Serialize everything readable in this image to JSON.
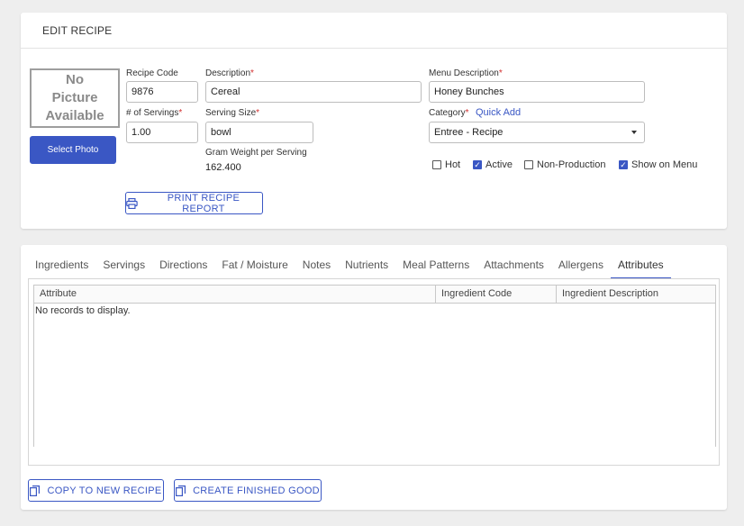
{
  "header": {
    "title": "EDIT RECIPE"
  },
  "photo": {
    "placeholder_line1": "No",
    "placeholder_line2": "Picture",
    "placeholder_line3": "Available",
    "select_label": "Select Photo"
  },
  "fields": {
    "recipe_code": {
      "label": "Recipe Code",
      "value": "9876"
    },
    "description": {
      "label": "Description",
      "required": "*",
      "value": "Cereal"
    },
    "menu_description": {
      "label": "Menu Description",
      "required": "*",
      "value": "Honey Bunches"
    },
    "servings": {
      "label": "# of Servings",
      "required": "*",
      "value": "1.00"
    },
    "serving_size": {
      "label": "Serving Size",
      "required": "*",
      "value": "bowl"
    },
    "category": {
      "label": "Category",
      "required": "*",
      "quick_add": "Quick Add",
      "value": "Entree - Recipe"
    },
    "gram_weight": {
      "label": "Gram Weight per Serving",
      "value": "162.400"
    }
  },
  "checkboxes": [
    {
      "label": "Hot",
      "checked": false
    },
    {
      "label": "Active",
      "checked": true
    },
    {
      "label": "Non-Production",
      "checked": false
    },
    {
      "label": "Show on Menu",
      "checked": true
    }
  ],
  "print_button": "PRINT RECIPE REPORT",
  "tabs": [
    "Ingredients",
    "Servings",
    "Directions",
    "Fat / Moisture",
    "Notes",
    "Nutrients",
    "Meal Patterns",
    "Attachments",
    "Allergens",
    "Attributes"
  ],
  "active_tab": "Attributes",
  "grid": {
    "columns": [
      "Attribute",
      "Ingredient Code",
      "Ingredient Description"
    ],
    "empty_message": "No records to display."
  },
  "footer": {
    "copy_button": "COPY TO NEW RECIPE",
    "finished_good_button": "CREATE FINISHED GOOD"
  },
  "colors": {
    "accent": "#3a57c4",
    "required": "#d32f2f",
    "background": "#eeeeee"
  }
}
